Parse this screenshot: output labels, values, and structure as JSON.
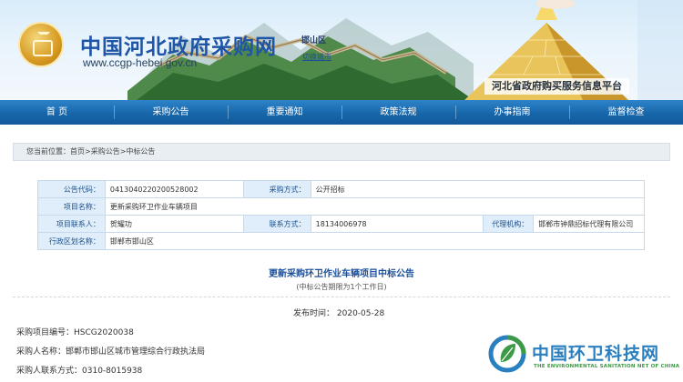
{
  "header": {
    "site_title": "中国河北政府采购网",
    "site_url": "www.ccgp-hebei.gov.cn",
    "region": "邯山区",
    "region_switch": "切换城市",
    "platform": "河北省政府购买服务信息平台"
  },
  "nav": {
    "items": [
      "首 页",
      "采购公告",
      "重要通知",
      "政策法规",
      "办事指南",
      "监督检查"
    ]
  },
  "breadcrumb": {
    "prefix": "您当前位置：",
    "home": "首页",
    "sep1": ">",
    "section": "采购公告",
    "sep2": ">",
    "current": "中标公告"
  },
  "info_table": {
    "code_label": "公告代码：",
    "code_value": "0413040220200528002",
    "method_label": "采购方式：",
    "method_value": "公开招标",
    "project_label": "项目名称：",
    "project_value": "更新采购环卫作业车辆项目",
    "contact_label": "项目联系人：",
    "contact_value": "贺耀功",
    "phone_label": "联系方式：",
    "phone_value": "18134006978",
    "agency_label": "代理机构：",
    "agency_value": "邯郸市钟鼎招标代理有限公司",
    "district_label": "行政区划名称：",
    "district_value": "邯郸市邯山区"
  },
  "notice": {
    "title": "更新采购环卫作业车辆项目中标公告",
    "subtitle": "(中标公告期限为1个工作日)",
    "publish_label": "发布时间：",
    "publish_date": "2020-05-28",
    "line1_label": "采购项目编号：",
    "line1_value": "HSCG2020038",
    "line2_label": "采购人名称：",
    "line2_value": "邯郸市邯山区城市管理综合行政执法局",
    "line3_label": "采购人联系方式：",
    "line3_value": "0310-8015938"
  },
  "watermark": {
    "text": "中国环卫科技网",
    "sub": "THE ENVIRONMENTAL SANITATION NET OF CHINA"
  },
  "colors": {
    "nav_blue": "#1766aa",
    "title_blue": "#1f55a6",
    "label_bg": "#dfeefa",
    "watermark_blue": "#2a7fbf",
    "watermark_green": "#3d9a46"
  }
}
